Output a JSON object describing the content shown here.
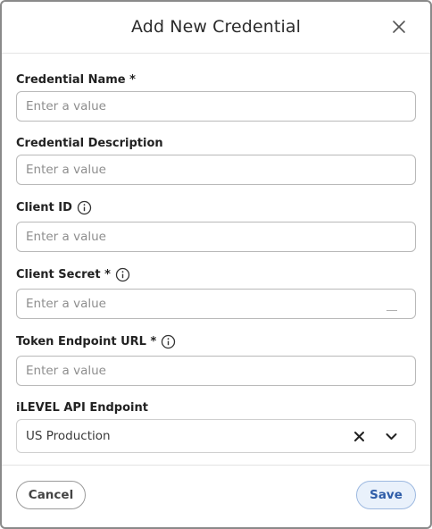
{
  "dialog": {
    "title": "Add New Credential"
  },
  "fields": {
    "credential_name": {
      "label": "Credential Name *",
      "placeholder": "Enter a value",
      "value": ""
    },
    "credential_description": {
      "label": "Credential Description",
      "placeholder": "Enter a value",
      "value": ""
    },
    "client_id": {
      "label": "Client ID",
      "placeholder": "Enter a value",
      "value": "",
      "info_icon": "info-icon"
    },
    "client_secret": {
      "label": "Client Secret *",
      "placeholder": "Enter a value",
      "value": "",
      "info_icon": "info-icon"
    },
    "token_endpoint_url": {
      "label": "Token Endpoint URL *",
      "placeholder": "Enter a value",
      "value": "",
      "info_icon": "info-icon"
    },
    "api_endpoint": {
      "label": "iLEVEL API Endpoint",
      "selected": "US Production"
    }
  },
  "footer": {
    "cancel_label": "Cancel",
    "save_label": "Save"
  },
  "colors": {
    "save_background": "#e9f1fb",
    "save_text": "#2f5da8",
    "border": "#b9b9b9"
  }
}
